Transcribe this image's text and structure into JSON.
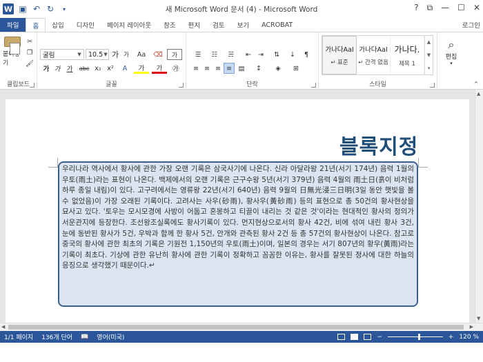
{
  "titlebar": {
    "title": "새 Microsoft Word 문서 (4) - Microsoft Word",
    "logo": "W",
    "controls": [
      "?",
      "⧉",
      "—",
      "☐",
      "✕"
    ]
  },
  "tabs": {
    "file": "파일",
    "items": [
      "홈",
      "삽입",
      "디자인",
      "페이지 레이아웃",
      "참조",
      "편지",
      "검토",
      "보기",
      "ACROBAT"
    ],
    "active": "홈",
    "login": "로그인"
  },
  "ribbon": {
    "clipboard": {
      "label": "클립보드",
      "paste": "붙여넣기"
    },
    "font": {
      "label": "글꼴",
      "font_name": "굴림",
      "font_size": "10.5",
      "grow": "가",
      "shrink": "가",
      "case": "Aa",
      "clear": "가",
      "bold": "가",
      "italic": "가",
      "underline": "가",
      "strike": "abc",
      "subscript": "x₂",
      "superscript": "x²",
      "highlight": "가",
      "fontcolor": "가"
    },
    "paragraph": {
      "label": "단락"
    },
    "styles": {
      "label": "스타일",
      "items": [
        {
          "sample": "가나다AaI",
          "name": "↵ 표준"
        },
        {
          "sample": "가나다AaI",
          "name": "↵ 간격 없음"
        },
        {
          "sample": "가나다.",
          "name": "제목 1"
        }
      ]
    },
    "editing": {
      "label": "편집"
    }
  },
  "document": {
    "heading": "블록지정",
    "body": "우리나라 역사에서 황사에 관한 가장 오랜 기록은 삼국사기에 나온다. 신라 아달라왕 21년(서기 174년) 음력 1월의 우토(雨土)라는 표현이 나온다. 백제에서의 오랜 기록은 근구수왕 5년(서기 379년) 음력 4월의 雨土日(흙이 비처럼 하루 종일 내림)이 있다. 고구려에서는 영류왕 22년(서기 640년) 음력 9월의 日無光浸三日明(3일 동안 햇빛을 볼 수 없었음)이 가장 오래된 기록이다. 고려사는 사우(砂雨), 황사우(黃砂雨) 등의 표현으로 총 50건의 황사현상을 묘사고 있다. '토우는 모시모경에 사방이 어둡고 혼몽하고 티끌이 내리는 것 같은 것'이라는 현대적인 황사의 정의가 서운관지에 등장한다. 조선왕조실록에도 황사기록이 있다. 먼지현상으로서의 황사 42건, 비에 섞여 내린 황사 3건, 눈에 동반된 황사가 5건, 우박과 함께 한 황사 5건, 안개와 관측된 황사 2건 등 총 57건의 황사현상이 나온다. 참고로 중국의 황사에 관한 최초의 기록은 기원전 1,150년의 우토(雨土)이며, 일본의 경우는 서기 807년의 황우(黃雨)라는 기록이 최초다. 기상에 관한 유난히 황사에 관한 기록이 정확하고 꼼꼼한 이유는, 황사를 잘못된 정사에 대한 하늘의 응징으로 생각했기 때문이다.↵"
  },
  "status": {
    "page": "1/1 페이지",
    "words": "136개 단어",
    "language": "영어(미국)",
    "zoom_level": 120,
    "zoom": "120 %"
  }
}
